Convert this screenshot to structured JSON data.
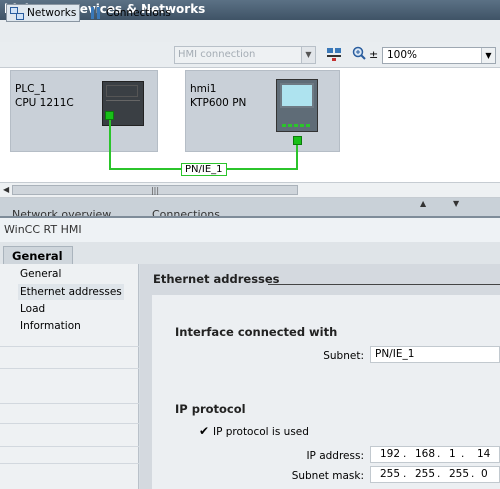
{
  "window": {
    "title": "blaja_1 > Devices & Networks"
  },
  "toolbar": {
    "networks_label": "Networks",
    "connections_label": "Connections",
    "connection_type_value": "HMI connection",
    "zoom_value": "100%"
  },
  "canvas": {
    "devices": [
      {
        "name": "PLC_1",
        "model": "CPU 1211C"
      },
      {
        "name": "hmi1",
        "model": "KTP600 PN"
      }
    ],
    "network_label": "PN/IE_1"
  },
  "bottom_tabs": [
    "Network overview",
    "Connections"
  ],
  "inspector": {
    "title": "WinCC RT HMI",
    "tab_general": "General",
    "nav_items": [
      "General",
      "Ethernet addresses",
      "Load",
      "Information"
    ],
    "section_title": "Ethernet addresses",
    "interface_heading": "Interface connected with",
    "subnet_label": "Subnet:",
    "subnet_value": "PN/IE_1",
    "ip_protocol_heading": "IP protocol",
    "ip_protocol_checkbox_label": "IP protocol is used",
    "ip_address_label": "IP address:",
    "ip_address": [
      "192",
      "168",
      "1",
      "14"
    ],
    "subnet_mask_label": "Subnet mask:",
    "subnet_mask": [
      "255",
      "255",
      "255",
      "0"
    ]
  },
  "colors": {
    "network_line": "#2bc42b",
    "title_bar": "#4a6075"
  }
}
